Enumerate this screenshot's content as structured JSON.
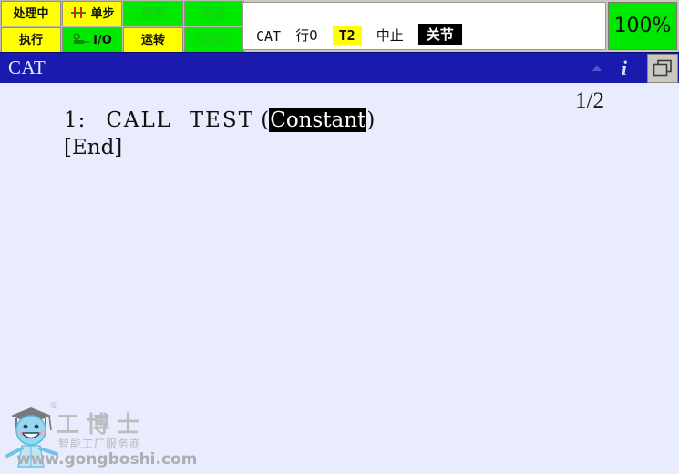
{
  "status_grid": {
    "cells": [
      {
        "label": "处理中",
        "style": "yellow",
        "icon": ""
      },
      {
        "label": "单步",
        "style": "yellow",
        "icon": "step-icon"
      },
      {
        "label": "暂停",
        "style": "green-dim",
        "icon": ""
      },
      {
        "label": "异常",
        "style": "green-dim",
        "icon": ""
      },
      {
        "label": "执行",
        "style": "yellow",
        "icon": ""
      },
      {
        "label": "I/O",
        "style": "green",
        "icon": "io-icon"
      },
      {
        "label": "运转",
        "style": "yellow",
        "icon": ""
      },
      {
        "label": "试运行",
        "style": "green-dim",
        "icon": ""
      }
    ]
  },
  "status_panel": {
    "program_name": "CAT",
    "line": "行0",
    "mode": "T2",
    "state": "中止",
    "coord": "关节"
  },
  "override": {
    "value": "100%"
  },
  "titlebar": {
    "title": "CAT",
    "info_icon": "i",
    "caret_icon": "caret-up-icon",
    "cascade_icon": "cascade-windows-icon"
  },
  "program": {
    "page_indicator": "1/2",
    "line_number": "1:",
    "command": "CALL  TEST",
    "paren_open": "(",
    "argument": "Constant",
    "paren_close": ")",
    "end_marker": "[End]"
  },
  "watermark": {
    "brand": "工博士",
    "tagline": "智能工厂服务商",
    "url": "www.gongboshi.com",
    "registered": "®"
  },
  "colors": {
    "yellow": "#ffff00",
    "green": "#00e800",
    "title_blue": "#1a1aae",
    "body_bg": "#e8ecfd",
    "selection_bg": "#000000"
  }
}
